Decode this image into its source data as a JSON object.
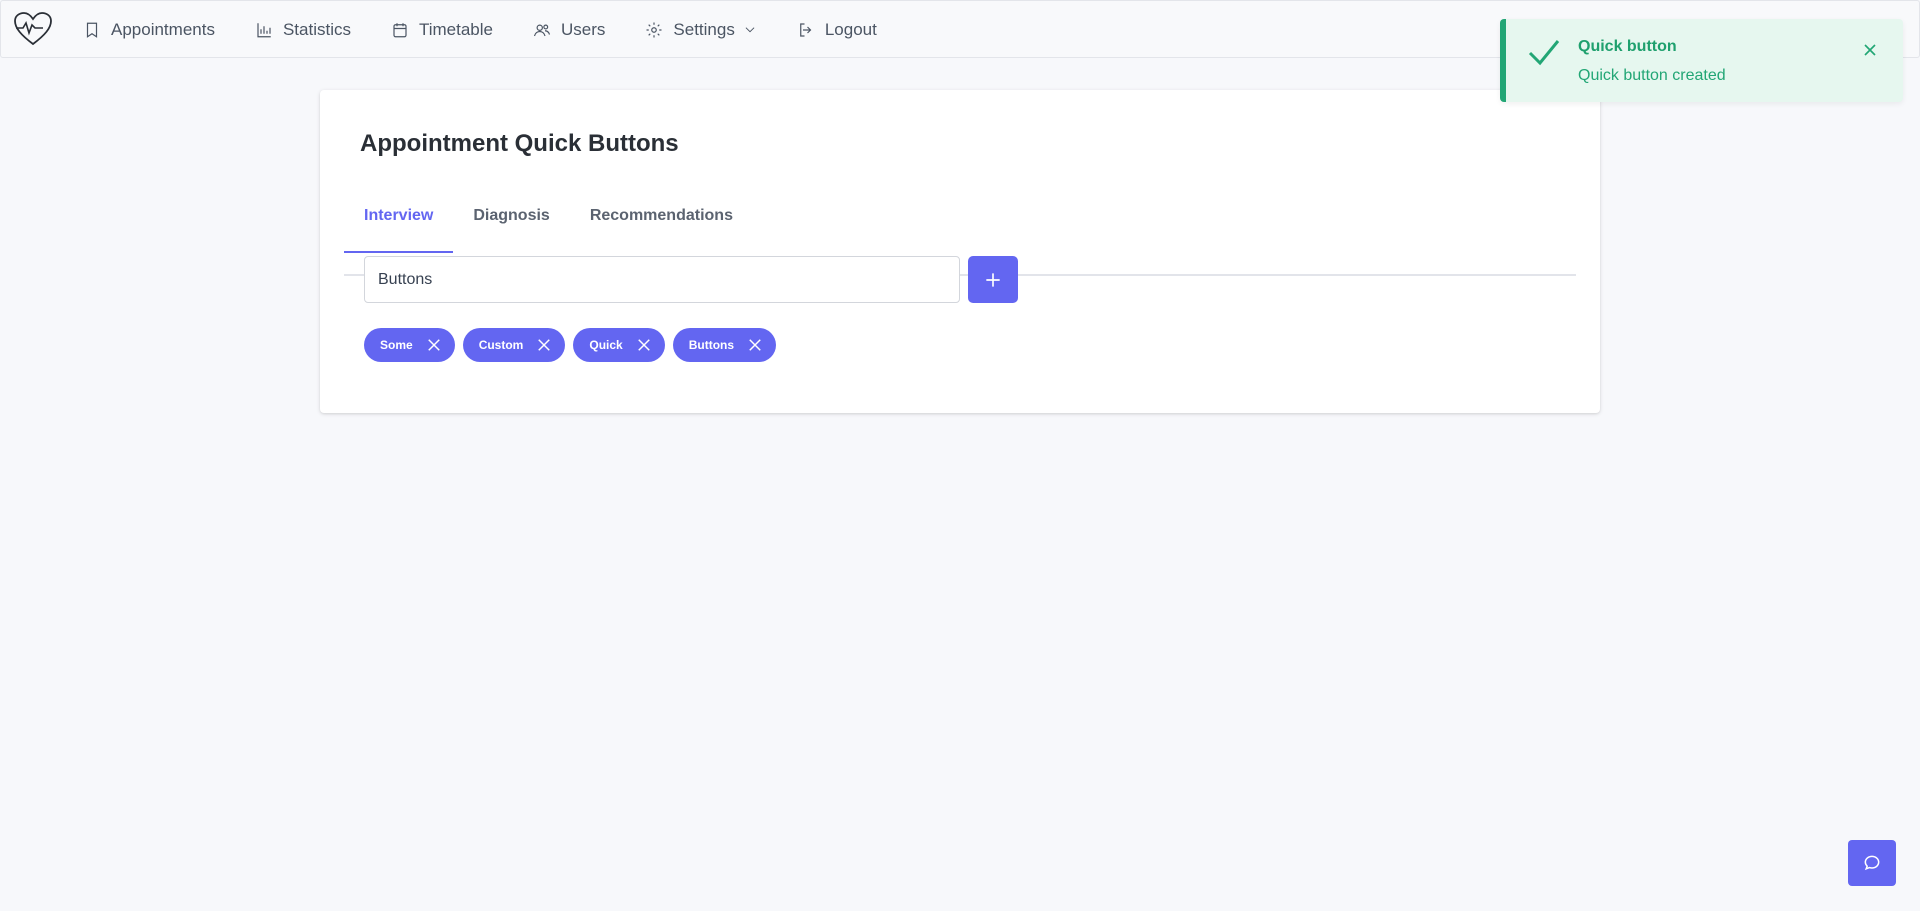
{
  "nav": {
    "items": [
      {
        "label": "Appointments",
        "icon": "bookmark-icon"
      },
      {
        "label": "Statistics",
        "icon": "bar-chart-icon"
      },
      {
        "label": "Timetable",
        "icon": "calendar-icon"
      },
      {
        "label": "Users",
        "icon": "users-icon"
      },
      {
        "label": "Settings",
        "icon": "gear-icon",
        "dropdown": true
      },
      {
        "label": "Logout",
        "icon": "logout-icon"
      }
    ]
  },
  "card": {
    "title": "Appointment Quick Buttons",
    "tabs": [
      {
        "label": "Interview",
        "active": true
      },
      {
        "label": "Diagnosis",
        "active": false
      },
      {
        "label": "Recommendations",
        "active": false
      }
    ],
    "input": {
      "value": "Buttons"
    },
    "chips": [
      "Some",
      "Custom",
      "Quick",
      "Buttons"
    ]
  },
  "toast": {
    "title": "Quick button",
    "message": "Quick button created"
  },
  "colors": {
    "accent": "#6366f1",
    "success": "#22a675",
    "success_bg": "#e6f7ef",
    "background": "#f7f8fb"
  }
}
